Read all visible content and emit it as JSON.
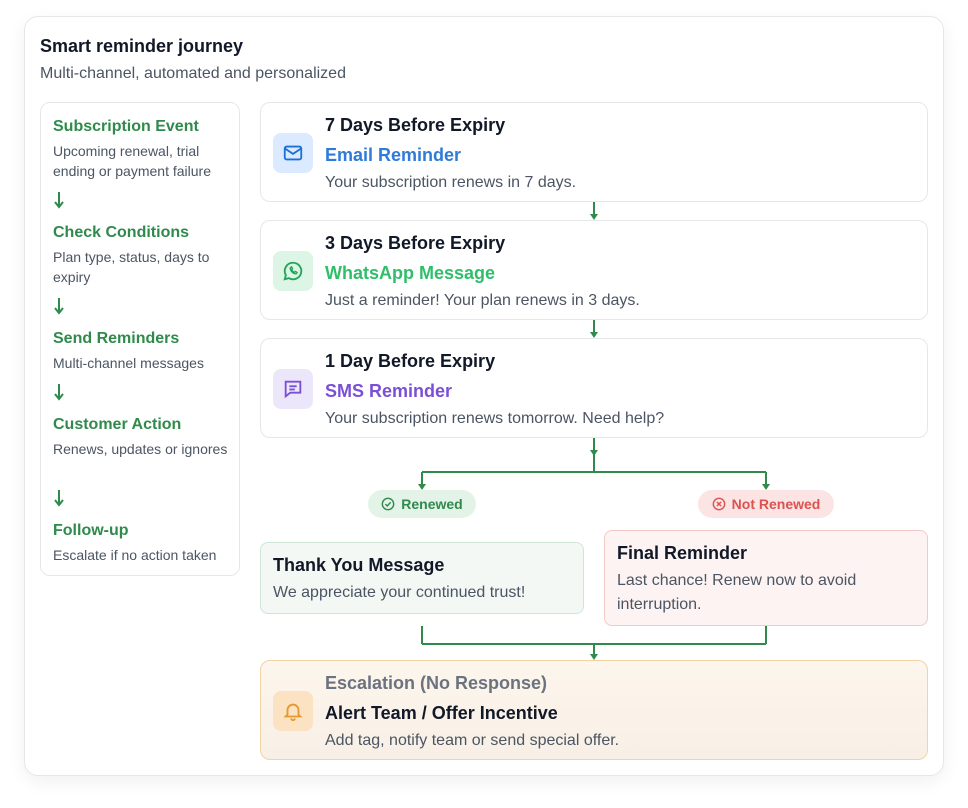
{
  "header": {
    "title": "Smart reminder journey",
    "subtitle": "Multi-channel, automated and personalized"
  },
  "steps": [
    {
      "title": "Subscription Event",
      "desc": "Upcoming renewal, trial ending or payment failure"
    },
    {
      "title": "Check Conditions",
      "desc": "Plan type, status, days to expiry"
    },
    {
      "title": "Send Reminders",
      "desc": "Multi-channel messages"
    },
    {
      "title": "Customer Action",
      "desc": "Renews, updates or ignores"
    },
    {
      "title": "Follow-up",
      "desc": "Escalate if no action taken"
    }
  ],
  "reminders": [
    {
      "when": "7 Days Before Expiry",
      "channel": "Email Reminder",
      "message": "Your subscription renews in 7 days.",
      "icon": "mail-icon",
      "color": "#2f7bd8"
    },
    {
      "when": "3 Days Before Expiry",
      "channel": "WhatsApp Message",
      "message": "Just a reminder! Your plan renews in 3 days.",
      "icon": "whatsapp-icon",
      "color": "#2fbf6a"
    },
    {
      "when": "1 Day Before Expiry",
      "channel": "SMS Reminder",
      "message": "Your subscription renews tomorrow. Need help?",
      "icon": "message-icon",
      "color": "#7b4fd6"
    }
  ],
  "branches": {
    "renewed": {
      "label": "Renewed",
      "color": "#2f8a4b",
      "icon": "check-circle-icon"
    },
    "not_renewed": {
      "label": "Not Renewed",
      "color": "#d9534f",
      "icon": "x-circle-icon"
    }
  },
  "outcomes": {
    "thank_you": {
      "title": "Thank You Message",
      "desc": "We appreciate your continued trust!"
    },
    "final": {
      "title": "Final Reminder",
      "desc": "Last chance! Renew now to avoid interruption."
    }
  },
  "escalation": {
    "label": "Escalation (No Response)",
    "title": "Alert Team / Offer Incentive",
    "desc": "Add tag, notify team or send special offer.",
    "icon": "bell-icon",
    "color": "#e39a2d"
  },
  "colors": {
    "accent_green": "#2f8a4b",
    "connector": "#2f8a4b"
  }
}
